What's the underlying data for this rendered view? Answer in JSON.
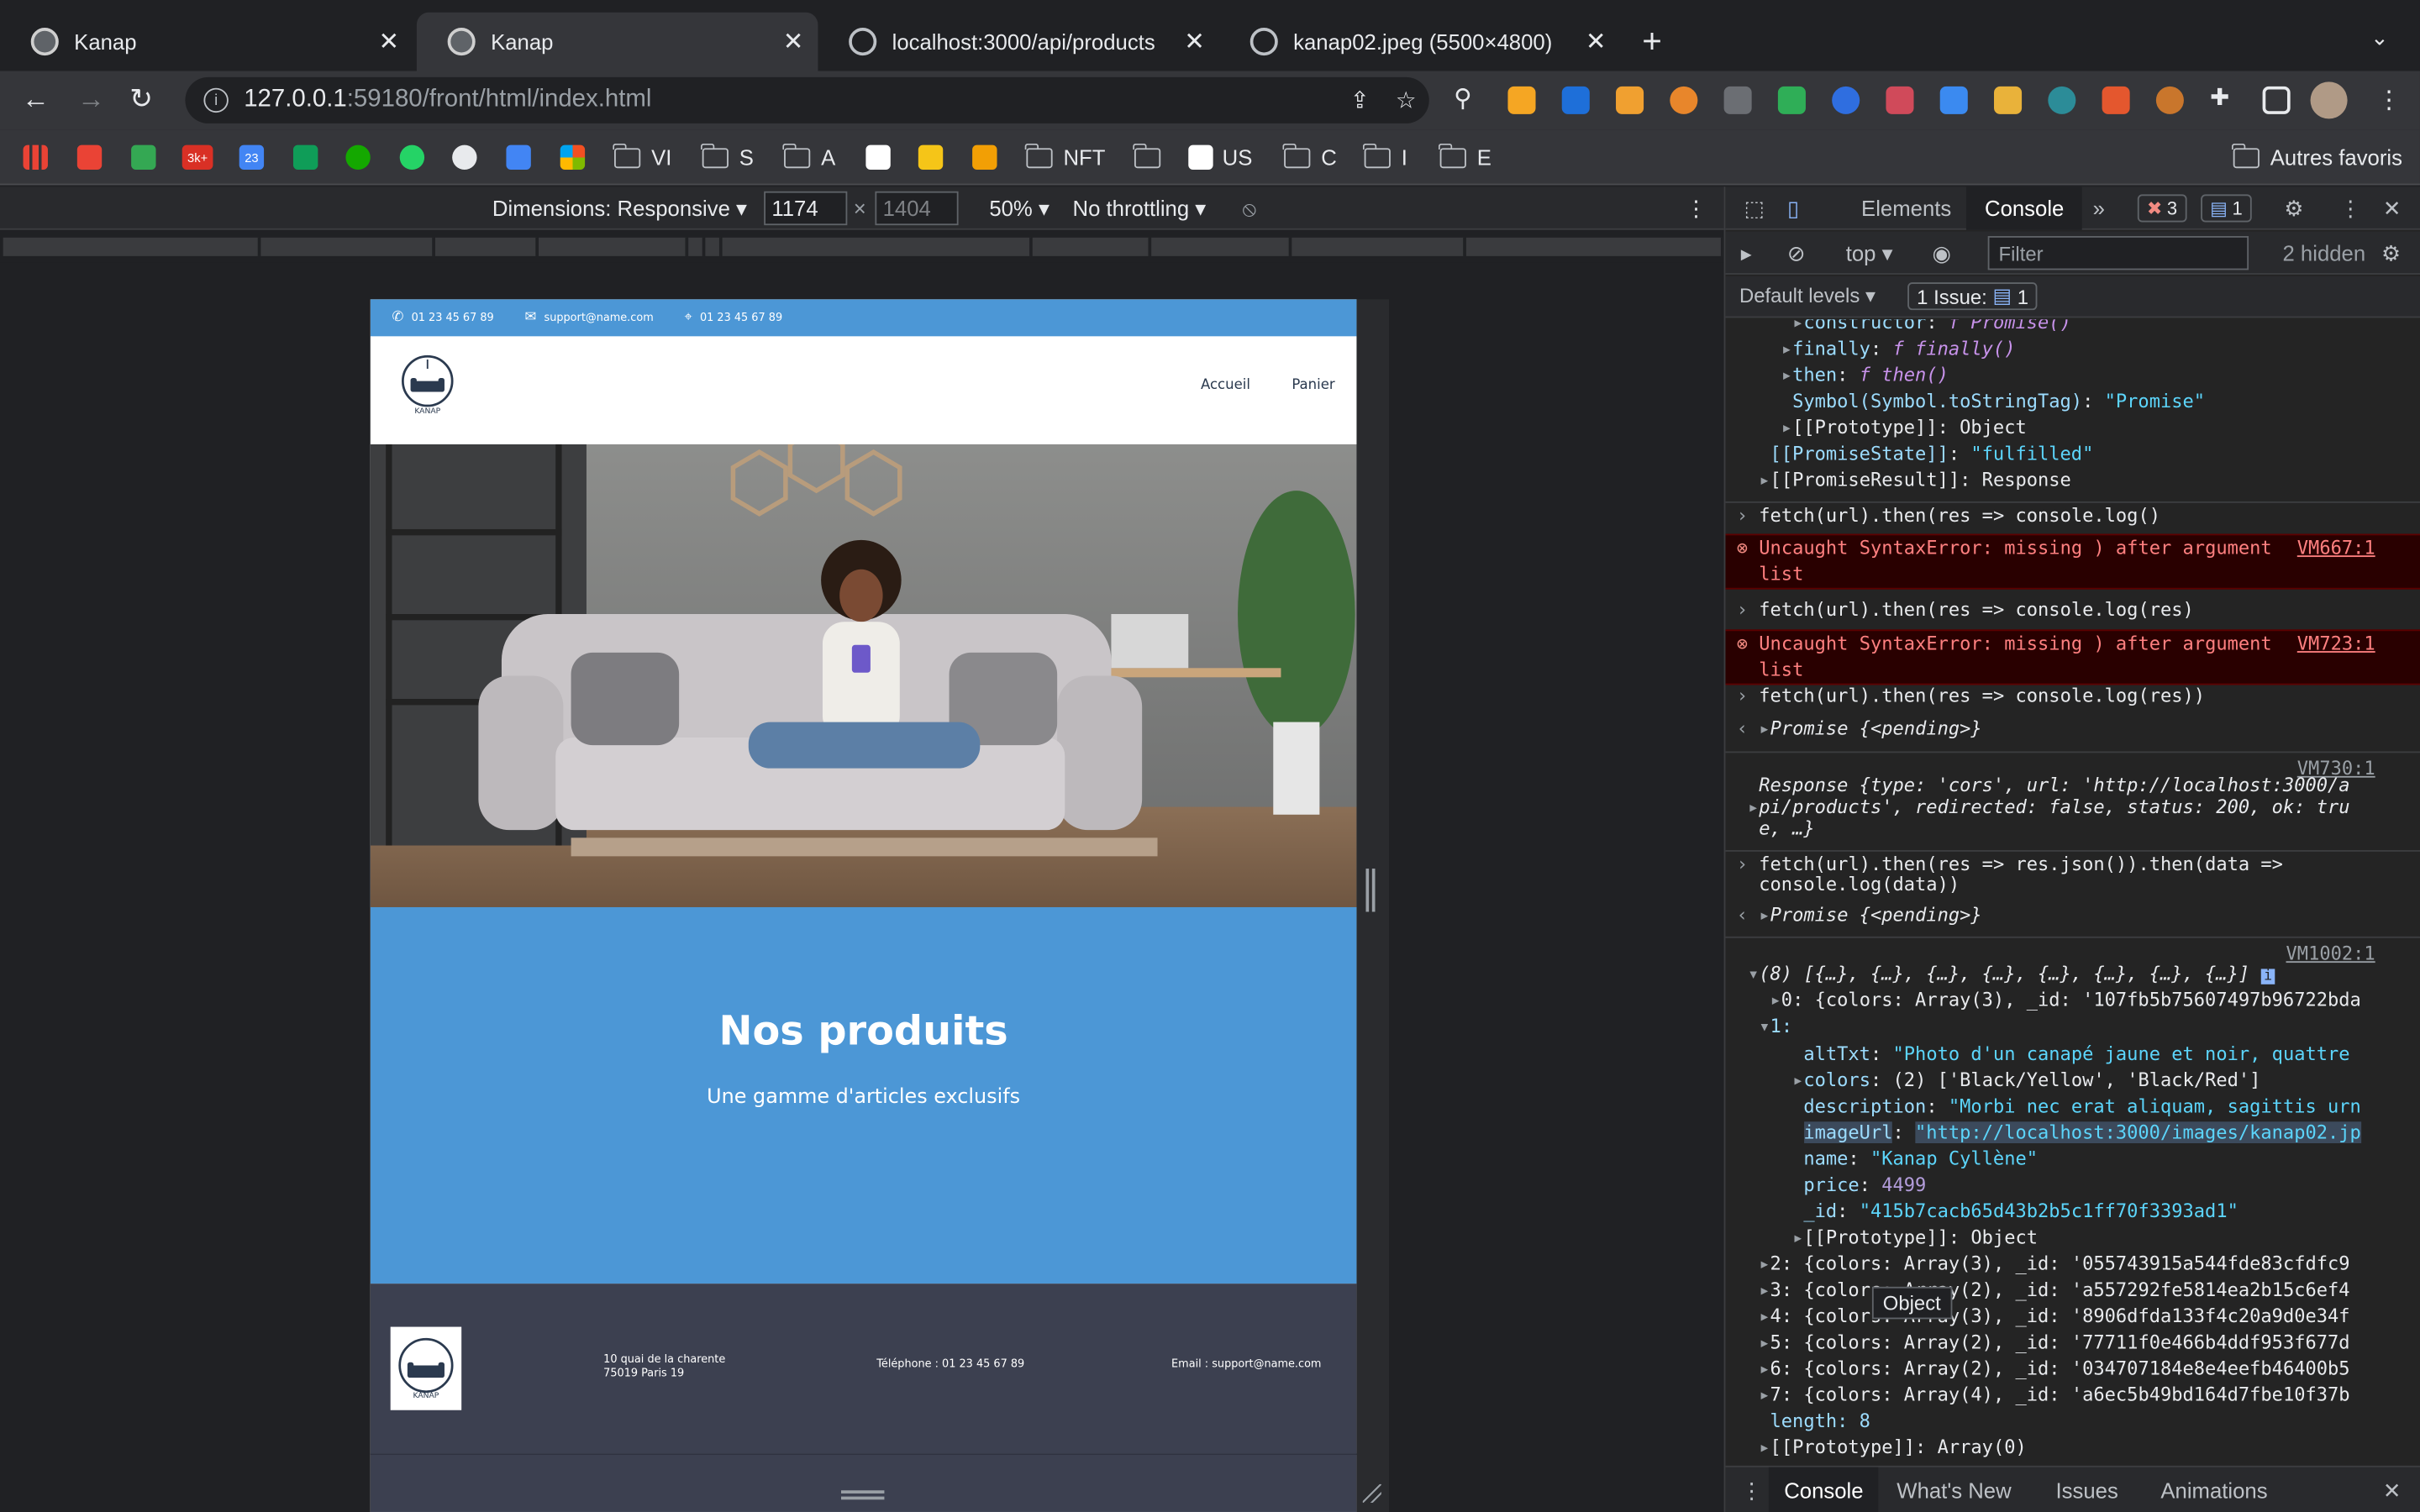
{
  "browser": {
    "tabs": [
      {
        "title": "Kanap",
        "active": false,
        "favicon": "kanap-icon"
      },
      {
        "title": "Kanap",
        "active": true,
        "favicon": "kanap-icon"
      },
      {
        "title": "localhost:3000/api/products",
        "active": false,
        "favicon": "globe-icon"
      },
      {
        "title": "kanap02.jpeg (5500×4800)",
        "active": false,
        "favicon": "globe-icon"
      }
    ],
    "url_host": "127.0.0.1",
    "url_rest": ":59180/front/html/index.html",
    "bookmarks": [
      "VI",
      "S",
      "A",
      "NFT",
      "US",
      "C",
      "I",
      "E"
    ],
    "bookmark_badge": "3k+",
    "bookmark_calendar": "23",
    "other_bookmarks": "Autres favoris"
  },
  "device_toolbar": {
    "dimensions_label": "Dimensions: Responsive",
    "width": "1174",
    "height": "1404",
    "zoom": "50%",
    "throttling": "No throttling"
  },
  "site": {
    "phone": "01 23 45 67 89",
    "email": "support@name.com",
    "location": "01 23 45 67 89",
    "brand": "KANAP",
    "nav": [
      "Accueil",
      "Panier"
    ],
    "products_title": "Nos produits",
    "products_subtitle": "Une gamme d'articles exclusifs",
    "footer": {
      "address_line1": "10 quai de la charente",
      "address_line2": "75019 Paris 19",
      "phone": "Téléphone : 01 23 45 67 89",
      "email": "Email : support@name.com"
    }
  },
  "devtools": {
    "tabs": [
      "Elements",
      "Console"
    ],
    "active_tab": "Console",
    "error_count": "3",
    "message_count": "1",
    "context": "top",
    "filter_placeholder": "Filter",
    "hidden": "2 hidden",
    "levels": "Default levels",
    "issues": "1 Issue:",
    "issues_count": "1",
    "bottom_tabs": [
      "Console",
      "What's New",
      "Issues",
      "Animations"
    ],
    "tooltip": "Object",
    "console": {
      "l1_key": "constructor",
      "l1_val": "f Promise()",
      "l2_key": "finally",
      "l2_val": "f finally()",
      "l3_key": "then",
      "l3_val": "f then()",
      "l4_key": "Symbol(Symbol.toStringTag)",
      "l4_val": "\"Promise\"",
      "l5": "[[Prototype]]: Object",
      "l6_key": "[[PromiseState]]",
      "l6_val": "\"fulfilled\"",
      "l7": "[[PromiseResult]]: Response",
      "cmd1": "fetch(url).then(res => console.log()",
      "err1_a": "Uncaught SyntaxError: missing ) after argument",
      "err1_b": "list",
      "err1_src": "VM667:1",
      "cmd2": "fetch(url).then(res => console.log(res)",
      "err2_a": "Uncaught SyntaxError: missing ) after argument",
      "err2_b": "list",
      "err2_src": "VM723:1",
      "cmd3": "fetch(url).then(res => console.log(res))",
      "ret1": "Promise {<pending>}",
      "src3": "VM730:1",
      "resp1": "Response {type: 'cors', url: 'http://localhost:3000/a",
      "resp2": "pi/products', redirected: false, status: 200, ok: tru",
      "resp3": "e, …}",
      "cmd4a": "fetch(url).then(res => res.json()).then(data =>",
      "cmd4b": "console.log(data))",
      "ret2": "Promise {<pending>}",
      "src4": "VM1002:1",
      "arr": "(8) [{…}, {…}, {…}, {…}, {…}, {…}, {…}, {…}]",
      "i0": "0: {colors: Array(3), _id: '107fb5b75607497b96722bda",
      "i1": "1:",
      "alt_key": "altTxt",
      "alt_val": "\"Photo d'un canapé jaune et noir, quattre",
      "colors_key": "colors",
      "colors_val": "(2) ['Black/Yellow', 'Black/Red']",
      "desc_key": "description",
      "desc_val": "\"Morbi nec erat aliquam, sagittis urn",
      "img_key": "imageUrl",
      "img_val": "\"http://localhost:3000/images/kanap02.jp",
      "name_key": "name",
      "name_val": "\"Kanap Cyllène\"",
      "price_key": "price",
      "price_val": "4499",
      "id_key": "_id",
      "id_val": "\"415b7cacb65d43b2b5c1ff70f3393ad1\"",
      "proto1": "[[Prototype]]: Object",
      "i2": "2: {colors: Array(3), _id: '055743915a544fde83cfdfc9",
      "i3": "3: {colors: Array(2), _id: 'a557292fe5814ea2b15c6ef4",
      "i4": "4: {colors: Array(3), _id: '8906dfda133f4c20a9d0e34f",
      "i5": "5: {colors: Array(2), _id: '77711f0e466b4ddf953f677d",
      "i6": "6: {colors: Array(2), _id: '034707184e8e4eefb46400b5",
      "i7": "7: {colors: Array(4), _id: 'a6ec5b49bd164d7fbe10f37b",
      "length": "length: 8",
      "proto2": "[[Prototype]]: Array(0)"
    }
  },
  "colors": {
    "site_blue": "#4c97d6",
    "footer_dark": "#3c4050",
    "devtools_bg": "#242424"
  }
}
